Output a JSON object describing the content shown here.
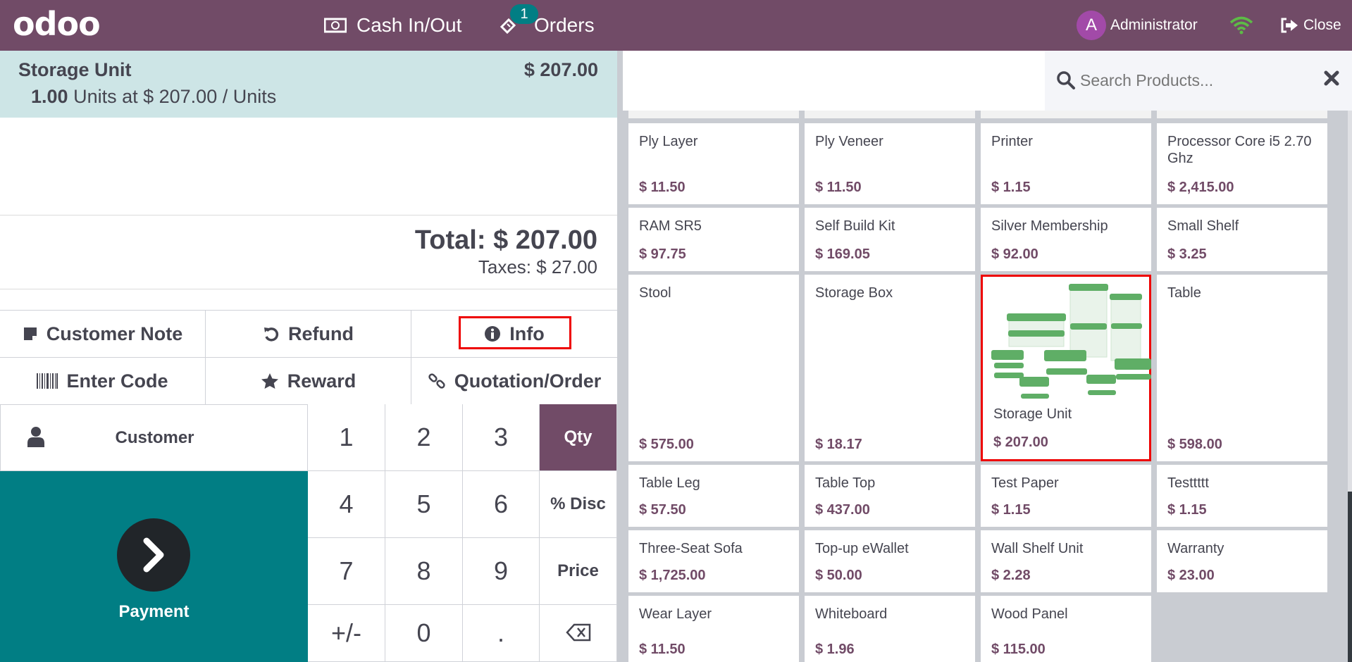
{
  "header": {
    "logo": "odoo",
    "cash_in_out": "Cash In/Out",
    "orders": "Orders",
    "orders_badge": "1",
    "user_initial": "A",
    "user_name": "Administrator",
    "close": "Close",
    "brand_color": "#714B67"
  },
  "order": {
    "line": {
      "name": "Storage Unit",
      "price": "$ 207.00",
      "qty": "1.00",
      "detail": "Units at $ 207.00 / Units"
    },
    "total": "Total: $ 207.00",
    "taxes": "Taxes: $ 27.00"
  },
  "controls": {
    "customer_note": "Customer Note",
    "refund": "Refund",
    "info": "Info",
    "enter_code": "Enter Code",
    "reward": "Reward",
    "quotation": "Quotation/Order"
  },
  "numpad": {
    "customer": "Customer",
    "payment": "Payment",
    "keys": [
      "1",
      "2",
      "3",
      "4",
      "5",
      "6",
      "7",
      "8",
      "9",
      "+/-",
      "0",
      "."
    ],
    "modes": {
      "qty": "Qty",
      "disc": "% Disc",
      "price": "Price"
    },
    "active_mode": "Qty"
  },
  "search": {
    "placeholder": "Search Products..."
  },
  "products": [
    {
      "name": "Ply Layer",
      "price": "$ 11.50"
    },
    {
      "name": "Ply Veneer",
      "price": "$ 11.50"
    },
    {
      "name": "Printer",
      "price": "$ 1.15"
    },
    {
      "name": "Processor Core i5 2.70 Ghz",
      "price": "$ 2,415.00"
    },
    {
      "name": "RAM SR5",
      "price": "$ 97.75"
    },
    {
      "name": "Self Build Kit",
      "price": "$ 169.05"
    },
    {
      "name": "Silver Membership",
      "price": "$ 92.00"
    },
    {
      "name": "Small Shelf",
      "price": "$ 3.25"
    },
    {
      "name": "Stool",
      "price": "$ 575.00"
    },
    {
      "name": "Storage Box",
      "price": "$ 18.17"
    },
    {
      "name": "Storage Unit",
      "price": "$ 207.00",
      "selected": true,
      "image": "storage-containers"
    },
    {
      "name": "Table",
      "price": "$ 598.00"
    },
    {
      "name": "Table Leg",
      "price": "$ 57.50"
    },
    {
      "name": "Table Top",
      "price": "$ 437.00"
    },
    {
      "name": "Test Paper",
      "price": "$ 1.15"
    },
    {
      "name": "Testtttt",
      "price": "$ 1.15"
    },
    {
      "name": "Three-Seat Sofa",
      "price": "$ 1,725.00"
    },
    {
      "name": "Top-up eWallet",
      "price": "$ 50.00"
    },
    {
      "name": "Wall Shelf Unit",
      "price": "$ 2.28"
    },
    {
      "name": "Warranty",
      "price": "$ 23.00"
    },
    {
      "name": "Wear Layer",
      "price": "$ 11.50"
    },
    {
      "name": "Whiteboard",
      "price": "$ 1.96"
    },
    {
      "name": "Wood Panel",
      "price": "$ 115.00"
    }
  ]
}
